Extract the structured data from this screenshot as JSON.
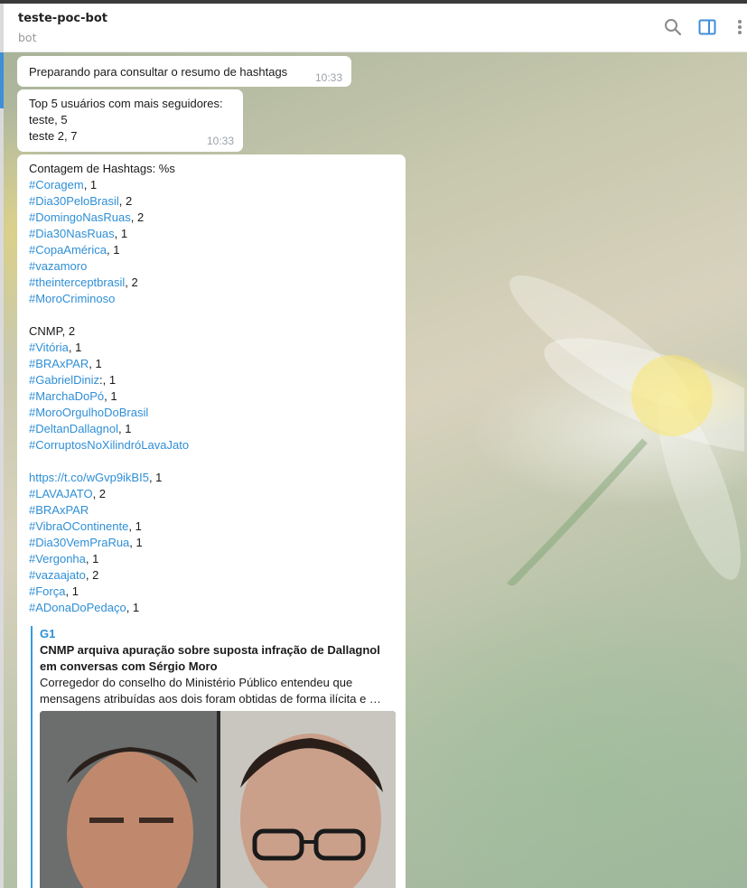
{
  "header": {
    "title": "teste-poc-bot",
    "subtitle": "bot"
  },
  "messages": {
    "msg1": {
      "text": "Preparando para consultar o resumo de hashtags",
      "time": "10:33"
    },
    "msg2": {
      "lines": [
        "Top 5 usuários com mais seguidores:",
        "teste, 5",
        "teste 2, 7"
      ],
      "time": "10:33"
    },
    "msg3": {
      "intro": "Contagem de Hashtags: %s",
      "group1": [
        {
          "tag": "#Coragem",
          "count": ", 1"
        },
        {
          "tag": "#Dia30PeloBrasil",
          "count": ", 2"
        },
        {
          "tag": "#DomingoNasRuas",
          "count": ", 2"
        },
        {
          "tag": "#Dia30NasRuas",
          "count": ", 1"
        },
        {
          "tag": "#CopaAmérica",
          "count": ", 1"
        },
        {
          "tag": "#vazamoro",
          "count": ""
        },
        {
          "tag": "#theinterceptbrasil",
          "count": ", 2"
        },
        {
          "tag": "#MoroCriminoso",
          "count": ""
        }
      ],
      "plain_line": "CNMP, 2",
      "group2": [
        {
          "tag": "#Vitória",
          "count": ", 1"
        },
        {
          "tag": "#BRAxPAR",
          "count": ", 1"
        },
        {
          "tag": "#GabrielDiniz",
          "count": ":, 1"
        },
        {
          "tag": "#MarchaDoPó",
          "count": ", 1"
        },
        {
          "tag": "#MoroOrgulhoDoBrasil",
          "count": ""
        },
        {
          "tag": "#DeltanDallagnol",
          "count": ", 1"
        },
        {
          "tag": "#CorruptosNoXilindróLavaJato",
          "count": ""
        }
      ],
      "url_line": {
        "url": "https://t.co/wGvp9ikBI5",
        "count": ", 1"
      },
      "group3": [
        {
          "tag": "#LAVAJATO",
          "count": ", 2"
        },
        {
          "tag": "#BRAxPAR",
          "count": ""
        },
        {
          "tag": "#VibraOContinente",
          "count": ", 1"
        },
        {
          "tag": "#Dia30VemPraRua",
          "count": ", 1"
        },
        {
          "tag": "#Vergonha",
          "count": ", 1"
        },
        {
          "tag": "#vazaajato",
          "count": ", 2"
        },
        {
          "tag": "#Força",
          "count": ", 1"
        },
        {
          "tag": "#ADonaDoPedaço",
          "count": ", 1"
        }
      ],
      "preview": {
        "site": "G1",
        "title": "CNMP arquiva apuração sobre suposta infração de Dallagnol em conversas com Sérgio Moro",
        "description": "Corregedor do conselho do Ministério Público entendeu que mensagens atribuídas aos dois foram obtidas de forma ilícita e …"
      }
    }
  },
  "icons": {
    "search": "search-icon",
    "panel": "sidebar-toggle-icon",
    "more": "more-vertical-icon"
  },
  "colors": {
    "link": "#2f8fd6",
    "accent": "#3f8ed8",
    "timestamp": "#9aa3a9"
  }
}
